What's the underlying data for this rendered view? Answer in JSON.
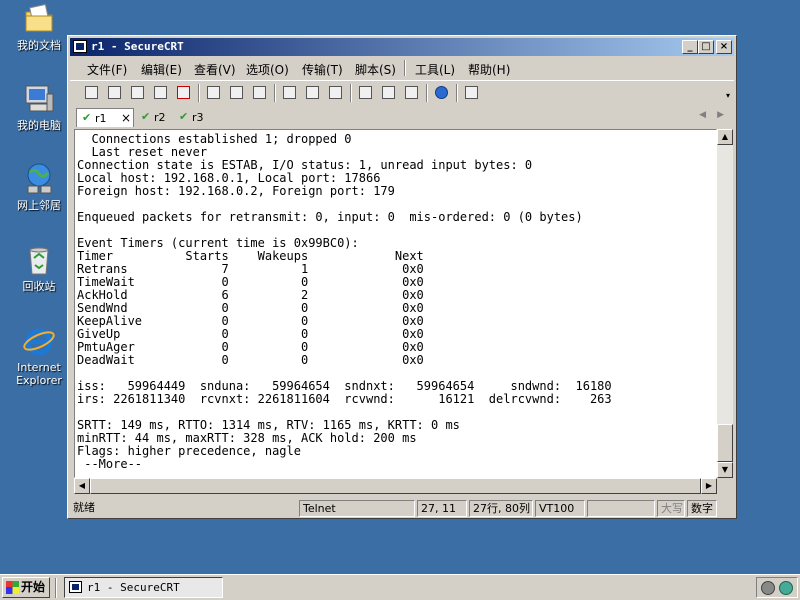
{
  "desktop": {
    "icons": [
      {
        "label": "我的文档",
        "icon": "my-documents-folder-icon"
      },
      {
        "label": "我的电脑",
        "icon": "my-computer-icon"
      },
      {
        "label": "网上邻居",
        "icon": "network-places-icon"
      },
      {
        "label": "回收站",
        "icon": "recycle-bin-icon"
      },
      {
        "label": "Internet Explorer",
        "icon": "internet-explorer-icon"
      }
    ]
  },
  "window": {
    "title": "r1 - SecureCRT",
    "controls": {
      "minimize": "_",
      "maximize": "□",
      "close": "×"
    }
  },
  "menu": [
    "文件(F)",
    "编辑(E)",
    "查看(V)",
    "选项(O)",
    "传输(T)",
    "脚本(S)",
    "工具(L)",
    "帮助(H)"
  ],
  "tabs": [
    {
      "label": "r1",
      "active": true,
      "close": "×"
    },
    {
      "label": "r2",
      "active": false
    },
    {
      "label": "r3",
      "active": false
    }
  ],
  "terminal": {
    "lines": [
      "  Connections established 1; dropped 0",
      "  Last reset never",
      "Connection state is ESTAB, I/O status: 1, unread input bytes: 0",
      "Local host: 192.168.0.1, Local port: 17866",
      "Foreign host: 192.168.0.2, Foreign port: 179",
      "",
      "Enqueued packets for retransmit: 0, input: 0  mis-ordered: 0 (0 bytes)",
      "",
      "Event Timers (current time is 0x99BC0):",
      "Timer          Starts    Wakeups            Next",
      "Retrans             7          1             0x0",
      "TimeWait            0          0             0x0",
      "AckHold             6          2             0x0",
      "SendWnd             0          0             0x0",
      "KeepAlive           0          0             0x0",
      "GiveUp              0          0             0x0",
      "PmtuAger            0          0             0x0",
      "DeadWait            0          0             0x0",
      "",
      "iss:   59964449  snduna:   59964654  sndnxt:   59964654     sndwnd:  16180",
      "irs: 2261811340  rcvnxt: 2261811604  rcvwnd:      16121  delrcvwnd:    263",
      "",
      "SRTT: 149 ms, RTTO: 1314 ms, RTV: 1165 ms, KRTT: 0 ms",
      "minRTT: 44 ms, maxRTT: 328 ms, ACK hold: 200 ms",
      "Flags: higher precedence, nagle",
      " --More--"
    ]
  },
  "statusbar": {
    "ready": "就绪",
    "protocol": "Telnet",
    "cursor": "27, 11",
    "size": "27行, 80列",
    "emulation": "VT100",
    "caps": "大写",
    "num": "数字"
  },
  "taskbar": {
    "start_label": "开始",
    "task_label": "r1 - SecureCRT"
  },
  "colors": {
    "desktop": "#3a6ea5",
    "titlebar_start": "#0a246a",
    "titlebar_end": "#a6caf0",
    "chrome": "#d4d0c8",
    "tab_check": "#2e9b2e"
  }
}
